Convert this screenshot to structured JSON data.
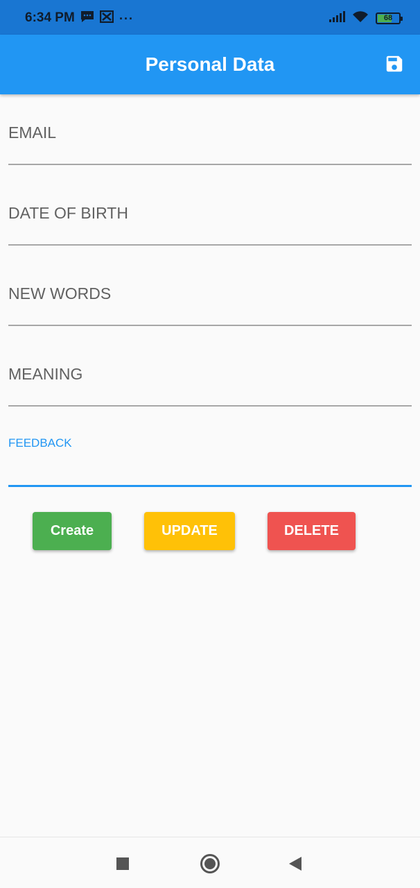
{
  "status_bar": {
    "time": "6:34 PM",
    "icons_left": [
      "message-icon",
      "vpn-key-icon"
    ],
    "more": "···",
    "icons_right": [
      "signal-icon",
      "wifi-icon",
      "battery-icon"
    ],
    "battery_level": "68"
  },
  "app_bar": {
    "title": "Personal Data",
    "action_icon": "save-icon"
  },
  "form": {
    "fields": [
      {
        "label": "EMAIL",
        "value": ""
      },
      {
        "label": "DATE OF BIRTH",
        "value": ""
      },
      {
        "label": "NEW WORDS",
        "value": ""
      },
      {
        "label": "MEANING",
        "value": ""
      },
      {
        "label": "FEEDBACK",
        "value": ""
      }
    ]
  },
  "actions": {
    "create_label": "Create",
    "update_label": "UPDATE",
    "delete_label": "DELETE"
  },
  "colors": {
    "status_bar": "#1976d2",
    "app_bar": "#2196f3",
    "create": "#4caf50",
    "update": "#ffc107",
    "delete": "#ef5350",
    "background": "#fafafa"
  },
  "nav_bar": {
    "icons": [
      "recent-apps-icon",
      "home-icon",
      "back-icon"
    ]
  }
}
